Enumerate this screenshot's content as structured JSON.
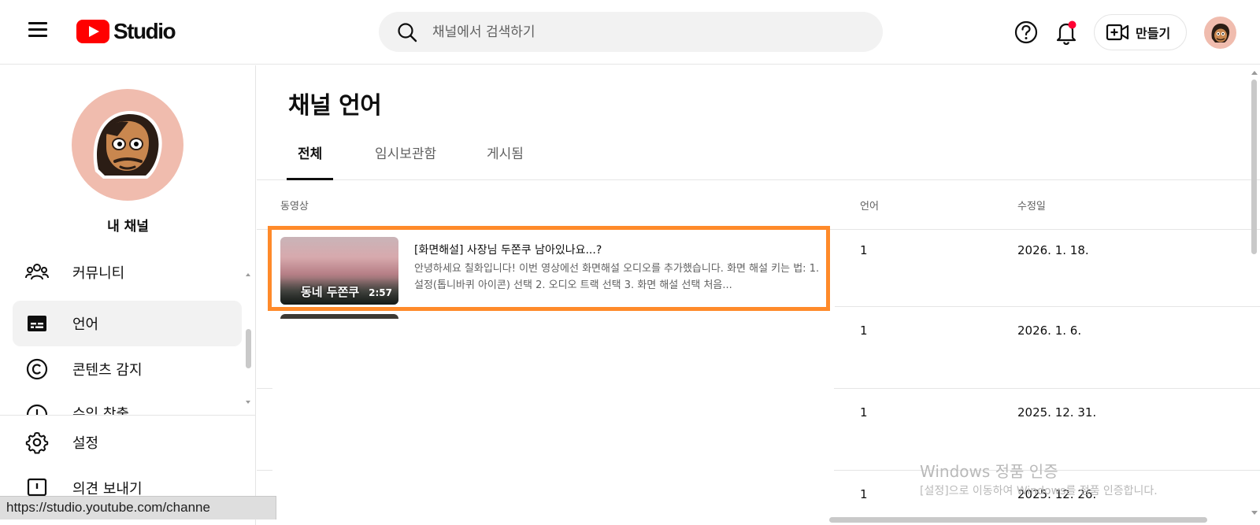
{
  "header": {
    "logo_text": "Studio",
    "search_placeholder": "채널에서 검색하기",
    "create_label": "만들기"
  },
  "sidebar": {
    "channel_label": "내 채널",
    "items": [
      {
        "label": "커뮤니티",
        "icon": "community-icon"
      },
      {
        "label": "언어",
        "icon": "subtitles-icon",
        "active": true
      },
      {
        "label": "콘텐츠 감지",
        "icon": "copyright-icon"
      },
      {
        "label": "수익 창출",
        "icon": "monetization-icon"
      },
      {
        "label": "설정",
        "icon": "gear-icon"
      },
      {
        "label": "의견 보내기",
        "icon": "feedback-icon"
      }
    ]
  },
  "main": {
    "title": "채널 언어",
    "tabs": [
      {
        "label": "전체",
        "active": true
      },
      {
        "label": "임시보관함"
      },
      {
        "label": "게시됨"
      }
    ],
    "columns": {
      "video": "동영상",
      "language": "언어",
      "modified": "수정일"
    },
    "rows": [
      {
        "title": "[화면해설] 사장님 두쫀쿠 남아있나요...?",
        "description": "안녕하세요 칠화입니다! 이번 영상에선 화면해설 오디오를 추가했습니다. 화면 해설 키는 법: 1. 설정(톱니바퀴 아이콘) 선택 2. 오디오 트랙 선택 3. 화면 해설 선택 처음...",
        "thumb_caption": "동네 두쫀쿠",
        "duration": "2:57",
        "language": "1",
        "modified": "2026. 1. 18."
      },
      {
        "language": "1",
        "modified": "2026. 1. 6."
      },
      {
        "language": "1",
        "modified": "2025. 12. 31."
      },
      {
        "language": "1",
        "modified": "2025. 12. 26."
      }
    ]
  },
  "watermark": {
    "line1": "Windows 정품 인증",
    "line2": "[설정]으로 이동하여 Windows를 정품 인증합니다."
  },
  "status_bar": {
    "url": "https://studio.youtube.com/channe"
  },
  "colors": {
    "highlight": "#ff8a2a",
    "brand_red": "#ff0000",
    "avatar_bg": "#f0bcae"
  }
}
